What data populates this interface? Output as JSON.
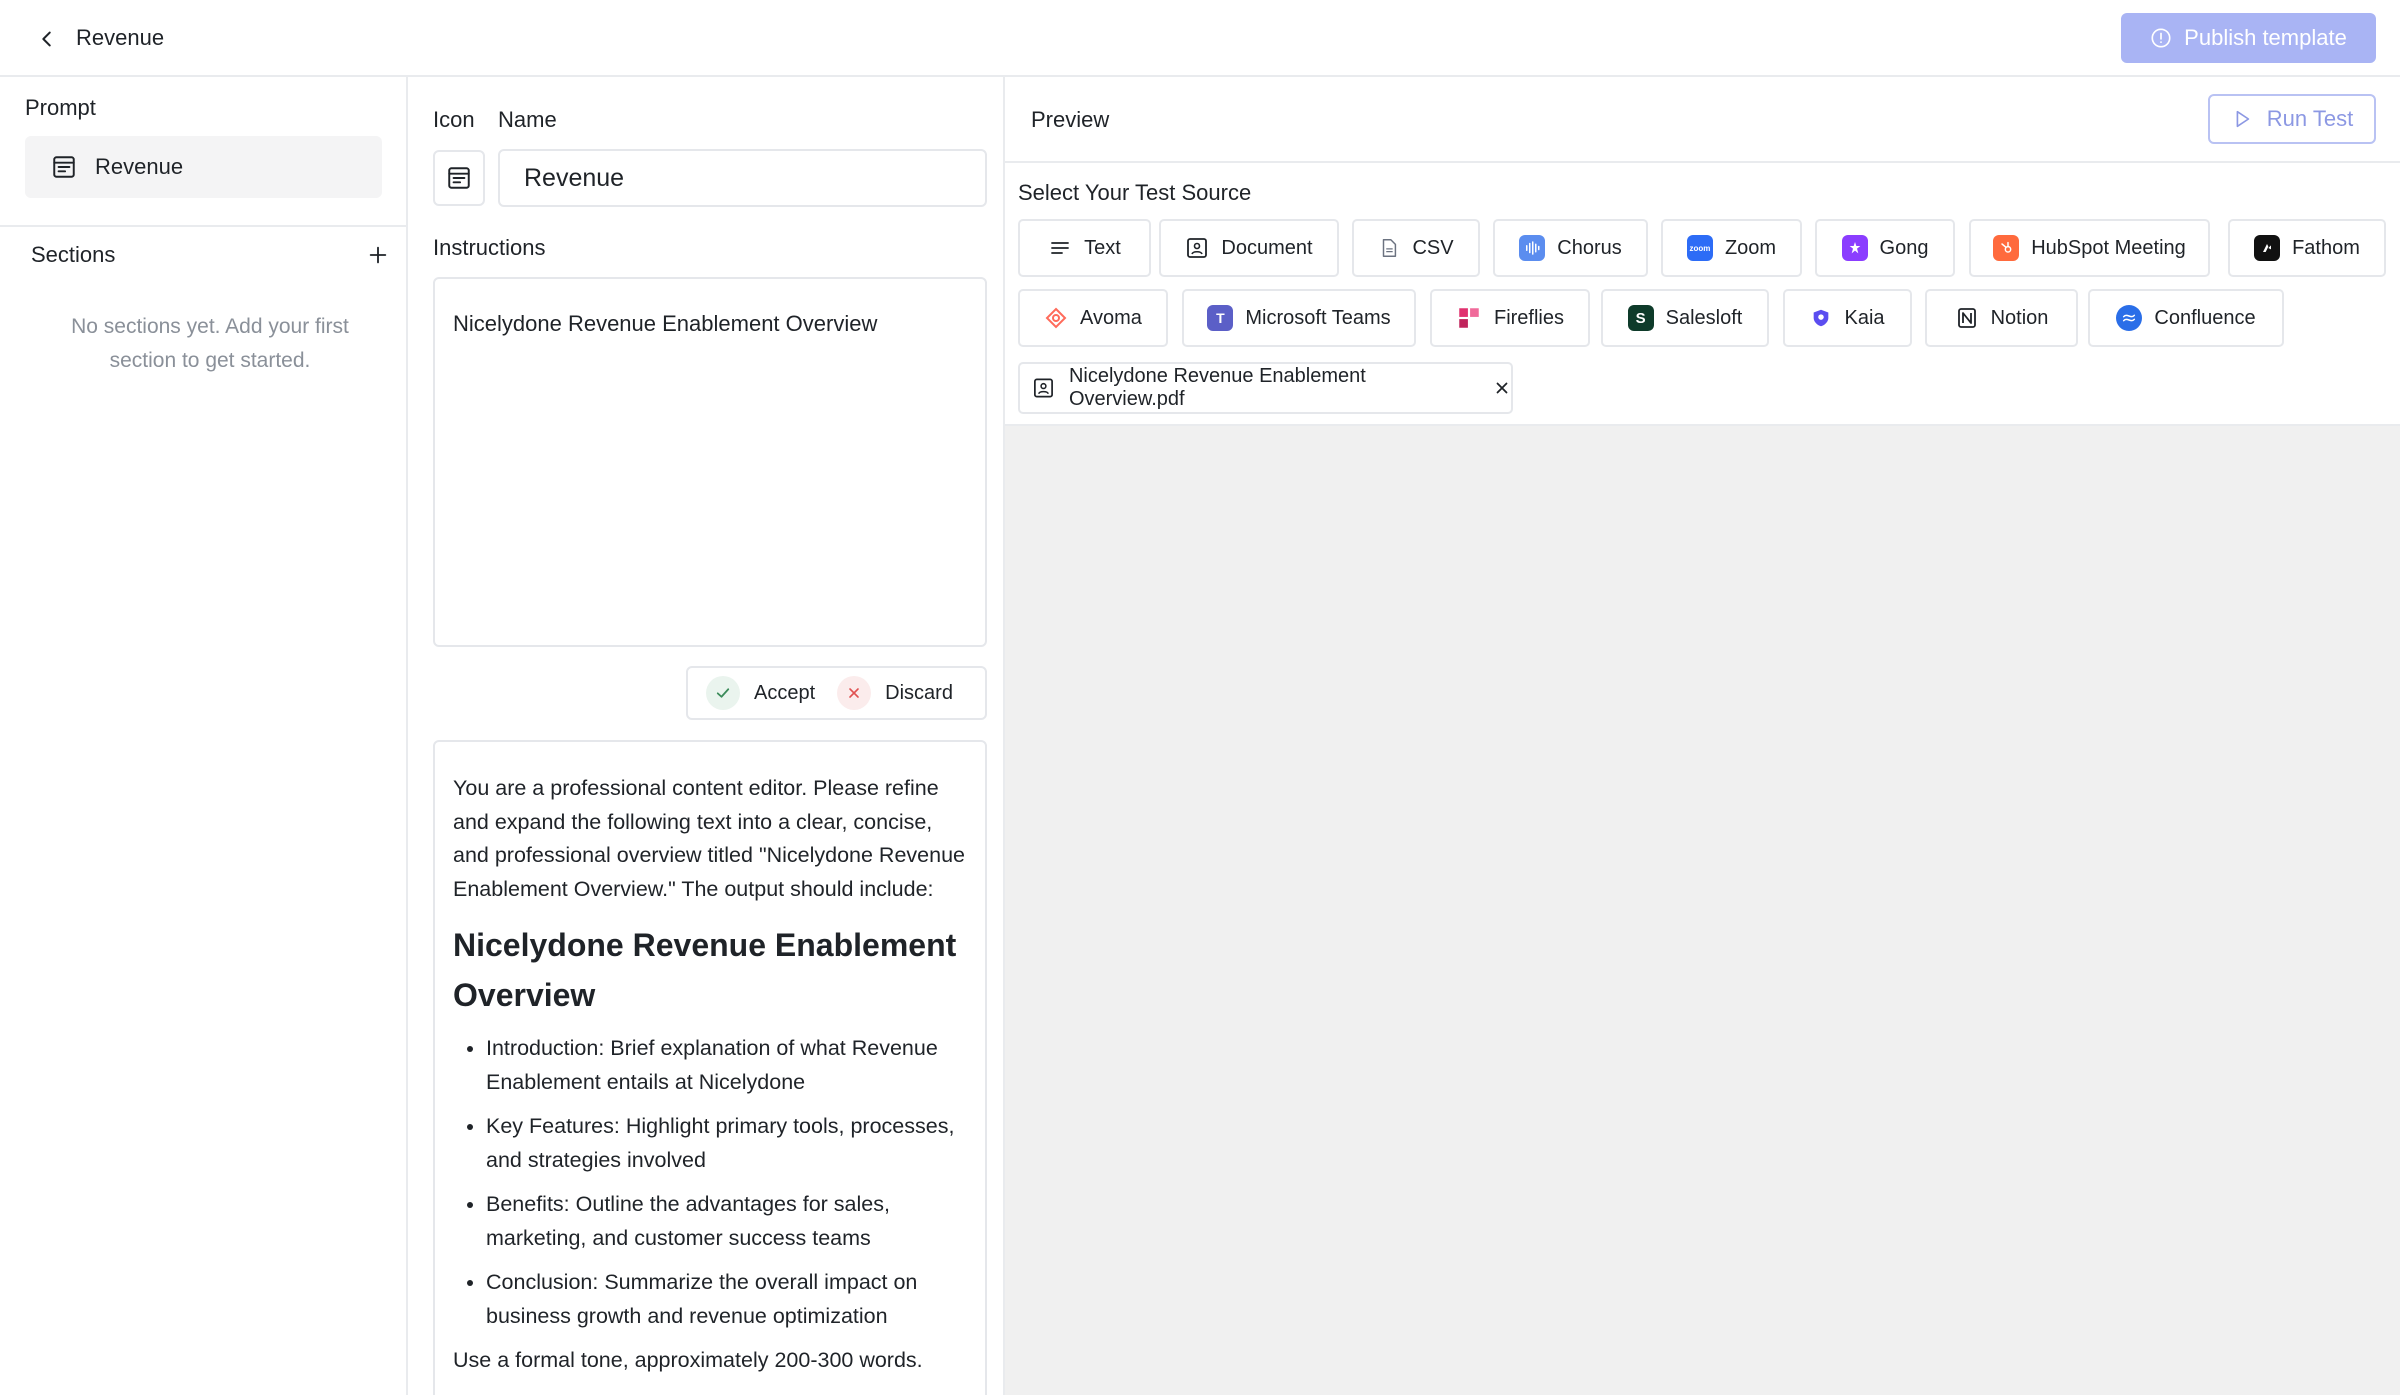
{
  "topbar": {
    "title": "Revenue",
    "publish_label": "Publish template"
  },
  "left": {
    "prompt_title": "Prompt",
    "prompt_item": "Revenue",
    "sections_title": "Sections",
    "empty_note": "No sections yet. Add your first section to get started."
  },
  "mid": {
    "icon_label": "Icon",
    "name_label": "Name",
    "name_value": "Revenue",
    "instructions_label": "Instructions",
    "instructions_value": "Nicelydone Revenue Enablement Overview",
    "accept_label": "Accept",
    "discard_label": "Discard",
    "result": {
      "intro": "You are a professional content editor. Please refine and expand the following text into a clear, concise, and professional overview titled \"Nicelydone Revenue Enablement Overview.\" The output should include:",
      "heading": "Nicelydone Revenue Enablement Overview",
      "bullets": [
        "Introduction: Brief explanation of what Revenue Enablement entails at Nicelydone",
        "Key Features: Highlight primary tools, processes, and strategies involved",
        "Benefits: Outline the advantages for sales, marketing, and customer success teams",
        "Conclusion: Summarize the overall impact on business growth and revenue optimization"
      ],
      "trailing": "Use a formal tone, approximately 200-300 words."
    }
  },
  "preview": {
    "title": "Preview",
    "run_label": "Run Test",
    "source_title": "Select Your Test Source",
    "sources": [
      {
        "label": "Text",
        "icon": "lines-icon",
        "color": "#ffffff"
      },
      {
        "label": "Document",
        "icon": "document-icon",
        "color": "#ffffff"
      },
      {
        "label": "CSV",
        "icon": "csv-file-icon",
        "color": "#ffffff"
      },
      {
        "label": "Chorus",
        "icon": "chorus-logo-icon",
        "color": "#5b8def"
      },
      {
        "label": "Zoom",
        "icon": "zoom-logo-icon",
        "color": "#2d6cf6"
      },
      {
        "label": "Gong",
        "icon": "gong-logo-icon",
        "color": "#8b3dff"
      },
      {
        "label": "HubSpot Meeting",
        "icon": "hubspot-logo-icon",
        "color": "#ff6a3d"
      },
      {
        "label": "Fathom",
        "icon": "fathom-logo-icon",
        "color": "#111111"
      },
      {
        "label": "Avoma",
        "icon": "avoma-logo-icon",
        "color": "#ff6b5b"
      },
      {
        "label": "Microsoft Teams",
        "icon": "teams-logo-icon",
        "color": "#5b5fc7"
      },
      {
        "label": "Fireflies",
        "icon": "fireflies-logo-icon",
        "color": "#e0306e"
      },
      {
        "label": "Salesloft",
        "icon": "salesloft-logo-icon",
        "color": "#0e3b2a"
      },
      {
        "label": "Kaia",
        "icon": "kaia-logo-icon",
        "color": "#5b4df0"
      },
      {
        "label": "Notion",
        "icon": "notion-logo-icon",
        "color": "#ffffff"
      },
      {
        "label": "Confluence",
        "icon": "confluence-logo-icon",
        "color": "#2a6ee8"
      }
    ],
    "file_name": "Nicelydone Revenue Enablement Overview.pdf"
  },
  "colors": {
    "accent": "#a9b4f4",
    "border": "#e5e7eb",
    "muted": "#8a9099"
  }
}
